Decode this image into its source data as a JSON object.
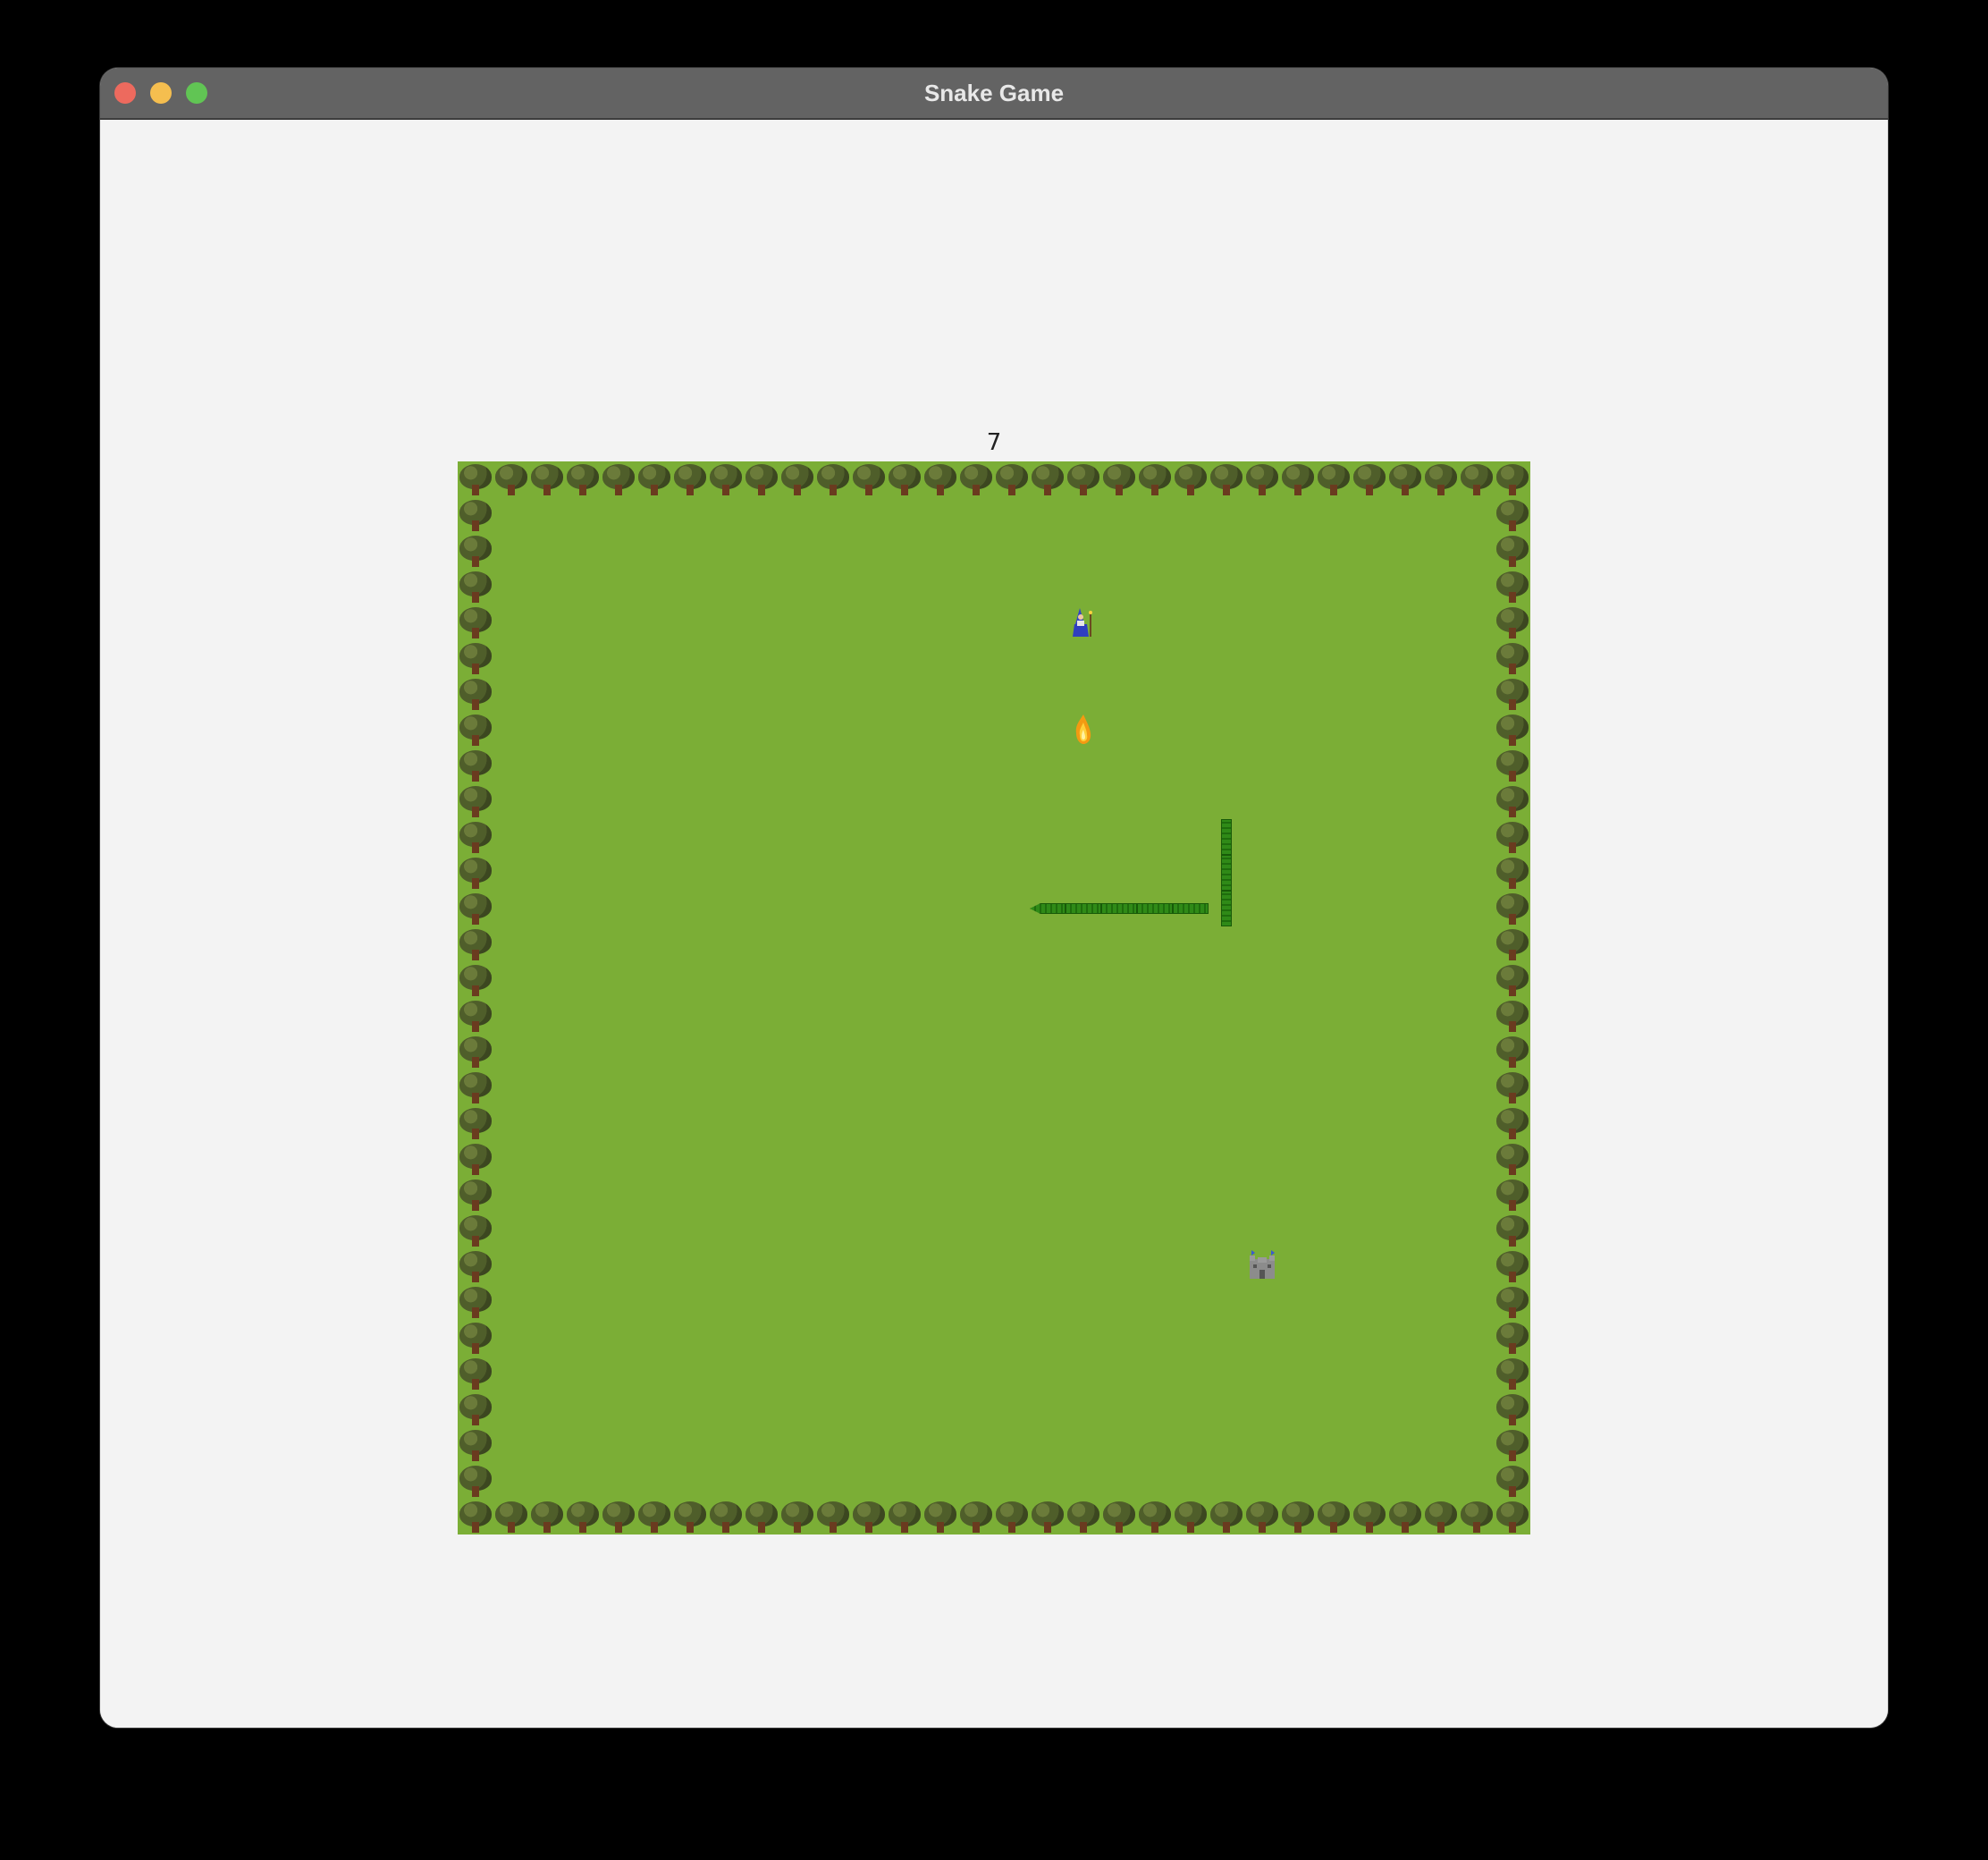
{
  "window": {
    "title": "Snake Game"
  },
  "game": {
    "score": "7",
    "grid": {
      "cols": 30,
      "rows": 30
    },
    "colors": {
      "grass": "#7bae36",
      "snake": "#2f8a17",
      "border_tree": "#4f5e2a"
    },
    "entities": {
      "wizard": {
        "icon": "wizard-icon",
        "cell": [
          17,
          4
        ]
      },
      "fire": {
        "icon": "fire-icon",
        "cell": [
          17,
          7
        ]
      },
      "castle": {
        "icon": "castle-icon",
        "cell": [
          22,
          22
        ]
      }
    },
    "snake": {
      "head_direction": "left",
      "cells": [
        [
          16,
          12
        ],
        [
          17,
          12
        ],
        [
          18,
          12
        ],
        [
          19,
          12
        ],
        [
          20,
          12
        ],
        [
          21,
          12
        ],
        [
          21,
          11
        ],
        [
          21,
          10
        ]
      ]
    }
  }
}
